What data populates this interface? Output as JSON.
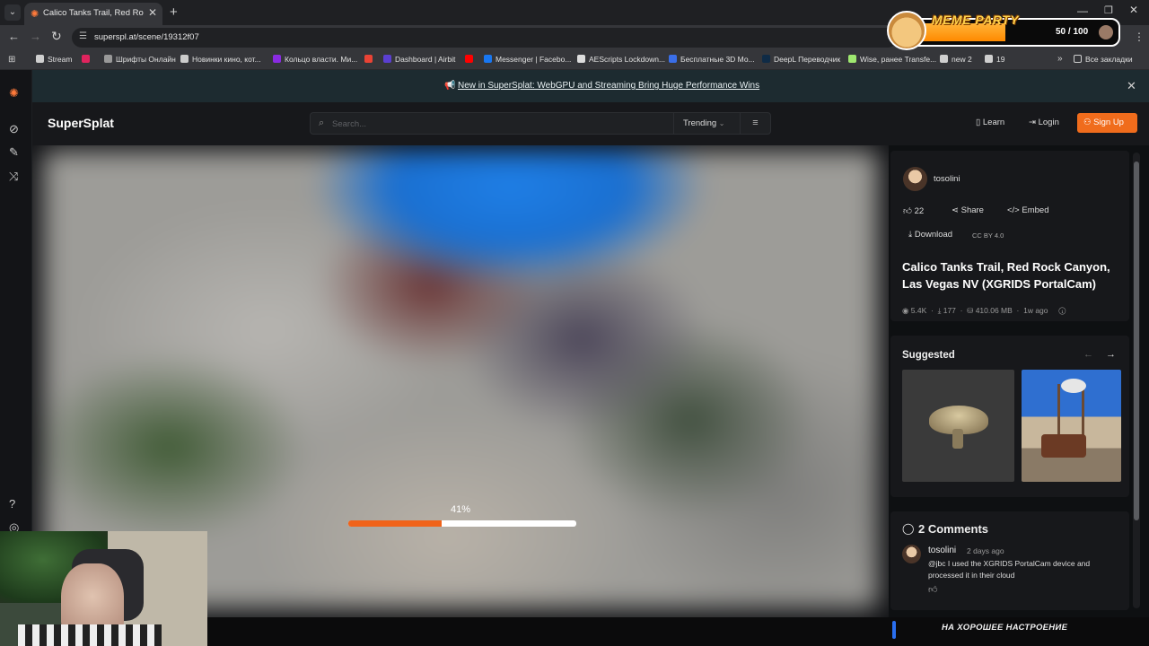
{
  "browser": {
    "tab_title": "Calico Tanks Trail, Red Rock Can",
    "url": "superspl.at/scene/19312f07",
    "bookmarks": [
      {
        "label": "Stream",
        "color": "#cfcfcf"
      },
      {
        "label": "",
        "color": "#e0245e"
      },
      {
        "label": "Шрифты Онлайн",
        "color": "#999999"
      },
      {
        "label": "Новинки кино, кот...",
        "color": "#cccccc"
      },
      {
        "label": "Кольцо власти. Ми...",
        "color": "#8a2be2"
      },
      {
        "label": "",
        "color": "#ea4335"
      },
      {
        "label": "Dashboard | Airbit",
        "color": "#5b3fd1"
      },
      {
        "label": "",
        "color": "#ff0000"
      },
      {
        "label": "Messenger | Facebo...",
        "color": "#1877f2"
      },
      {
        "label": "AEScripts Lockdown...",
        "color": "#dddddd"
      },
      {
        "label": "Бесплатные 3D Мо...",
        "color": "#3a6ee8"
      },
      {
        "label": "DeepL Переводчик",
        "color": "#0f2b46"
      },
      {
        "label": "Wise, ранее Transfe...",
        "color": "#9fe870"
      },
      {
        "label": "new 2",
        "color": "#cfcfcf"
      },
      {
        "label": "19",
        "color": "#cfcfcf"
      }
    ],
    "all_bookmarks": "Все закладки"
  },
  "overlay": {
    "meme_title": "MEME PARTY",
    "meme_count": "50 / 100",
    "meme_progress": 0.5,
    "bottom_text": "НА ХОРОШЕЕ НАСТРОЕНИЕ"
  },
  "announcement": "New in SuperSplat: WebGPU and Streaming Bring Huge Performance Wins",
  "header": {
    "logo": "SuperSplat",
    "search_placeholder": "Search...",
    "sort": "Trending",
    "learn": "Learn",
    "login": "Login",
    "signup": "Sign Up"
  },
  "viewer": {
    "progress_label": "41%",
    "progress": 0.41
  },
  "scene": {
    "author": "tosolini",
    "likes": "22",
    "share": "Share",
    "embed": "Embed",
    "download": "Download",
    "license": "CC BY 4.0",
    "title": "Calico Tanks Trail, Red Rock Canyon, Las Vegas NV (XGRIDS PortalCam)",
    "views": "5.4K",
    "downloads": "177",
    "size": "410.06 MB",
    "age": "1w ago"
  },
  "suggested": {
    "title": "Suggested"
  },
  "comments": {
    "title": "2 Comments",
    "items": [
      {
        "author": "tosolini",
        "time": "2 days ago",
        "text": "@jbc I used the XGRIDS PortalCam device and processed it in their cloud"
      }
    ]
  },
  "colors": {
    "accent": "#f06c1c",
    "announce_bg": "#1d2b30"
  }
}
